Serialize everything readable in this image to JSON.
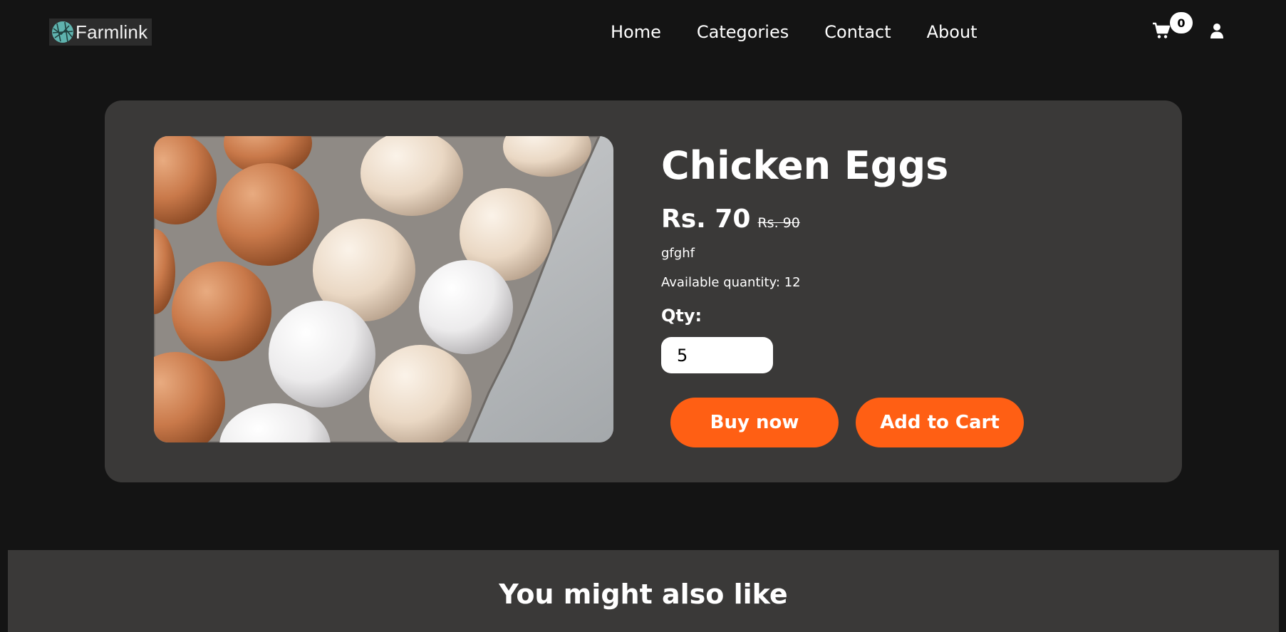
{
  "brand": {
    "name": "Farmlink",
    "logo_icon": "globe-logo-icon",
    "logo_color": "#5fb3ae"
  },
  "nav": {
    "links": [
      "Home",
      "Categories",
      "Contact",
      "About"
    ],
    "cart_icon": "shopping-cart-icon",
    "cart_count": "0",
    "user_icon": "user-icon"
  },
  "product": {
    "title": "Chicken Eggs",
    "price": "Rs. 70",
    "old_price": "Rs. 90",
    "description": "gfghf",
    "availability": "Available quantity: 12",
    "qty_label": "Qty:",
    "qty_value": "5",
    "buy_label": "Buy now",
    "cart_label": "Add to Cart",
    "image_subject": "brown and white eggs in a cardboard egg tray"
  },
  "recommendations": {
    "title": "You might also like"
  },
  "colors": {
    "background": "#141414",
    "card": "#3a3938",
    "accent": "#ff5f14",
    "text": "#ffffff"
  }
}
